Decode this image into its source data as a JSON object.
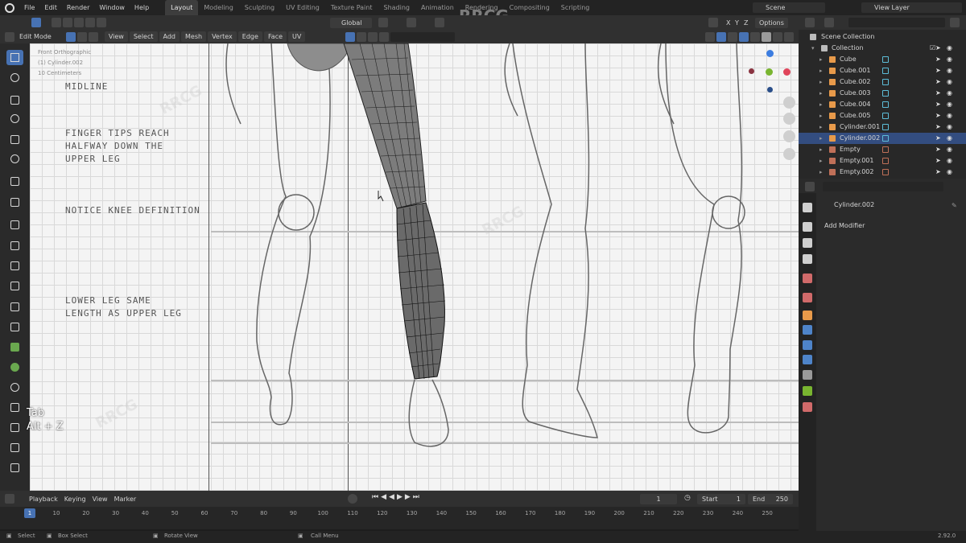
{
  "watermark": "RRCG",
  "menu": {
    "items": [
      "File",
      "Edit",
      "Render",
      "Window",
      "Help"
    ],
    "workspaces": [
      "Layout",
      "Modeling",
      "Sculpting",
      "UV Editing",
      "Texture Paint",
      "Shading",
      "Animation",
      "Rendering",
      "Compositing",
      "Scripting"
    ],
    "active_workspace": "Layout",
    "scene": "Scene",
    "view_layer": "View Layer"
  },
  "tool_header": {
    "transform_orientation": "Global",
    "axes": [
      "X",
      "Y",
      "Z"
    ],
    "options": "Options"
  },
  "view_header": {
    "mode": "Edit Mode",
    "menus": [
      "View",
      "Select",
      "Add",
      "Mesh",
      "Vertex",
      "Edge",
      "Face",
      "UV"
    ]
  },
  "viewport": {
    "info_lines": [
      "Front Orthographic",
      "(1) Cylinder.002",
      "10 Centimeters"
    ],
    "notes": [
      [
        "MIDLINE"
      ],
      [
        "FINGER TIPS REACH",
        "HALFWAY DOWN THE",
        "UPPER LEG"
      ],
      [
        "NOTICE KNEE DEFINITION"
      ],
      [
        "LOWER LEG SAME",
        "LENGTH AS UPPER LEG"
      ]
    ],
    "key_hints": [
      "Tab",
      "Alt + Z"
    ],
    "gizmo_colors": {
      "x": "#e0455b",
      "y": "#79b530",
      "z": "#3c7de0"
    }
  },
  "outliner": {
    "header": "Scene Collection",
    "collection": "Collection",
    "objects": [
      {
        "name": "Cube",
        "selected": false
      },
      {
        "name": "Cube.001",
        "selected": false
      },
      {
        "name": "Cube.002",
        "selected": false
      },
      {
        "name": "Cube.003",
        "selected": false
      },
      {
        "name": "Cube.004",
        "selected": false
      },
      {
        "name": "Cube.005",
        "selected": false
      },
      {
        "name": "Cylinder.001",
        "selected": false
      },
      {
        "name": "Cylinder.002",
        "selected": true
      },
      {
        "name": "Empty",
        "selected": false
      },
      {
        "name": "Empty.001",
        "selected": false
      },
      {
        "name": "Empty.002",
        "selected": false
      }
    ]
  },
  "properties": {
    "object_name": "Cylinder.002",
    "add_modifier": "Add Modifier"
  },
  "timeline": {
    "menus": [
      "Playback",
      "Keying",
      "View",
      "Marker"
    ],
    "current_frame": "1",
    "start_label": "Start",
    "start": "1",
    "end_label": "End",
    "end": "250",
    "playhead": "1",
    "ticks": [
      "10",
      "20",
      "30",
      "40",
      "50",
      "60",
      "70",
      "80",
      "90",
      "100",
      "110",
      "120",
      "130",
      "140",
      "150",
      "160",
      "170",
      "180",
      "190",
      "200",
      "210",
      "220",
      "230",
      "240",
      "250"
    ]
  },
  "status": {
    "select": "Select",
    "box_select": "Box Select",
    "rotate_view": "Rotate View",
    "call_menu": "Call Menu",
    "version": "2.92.0"
  }
}
